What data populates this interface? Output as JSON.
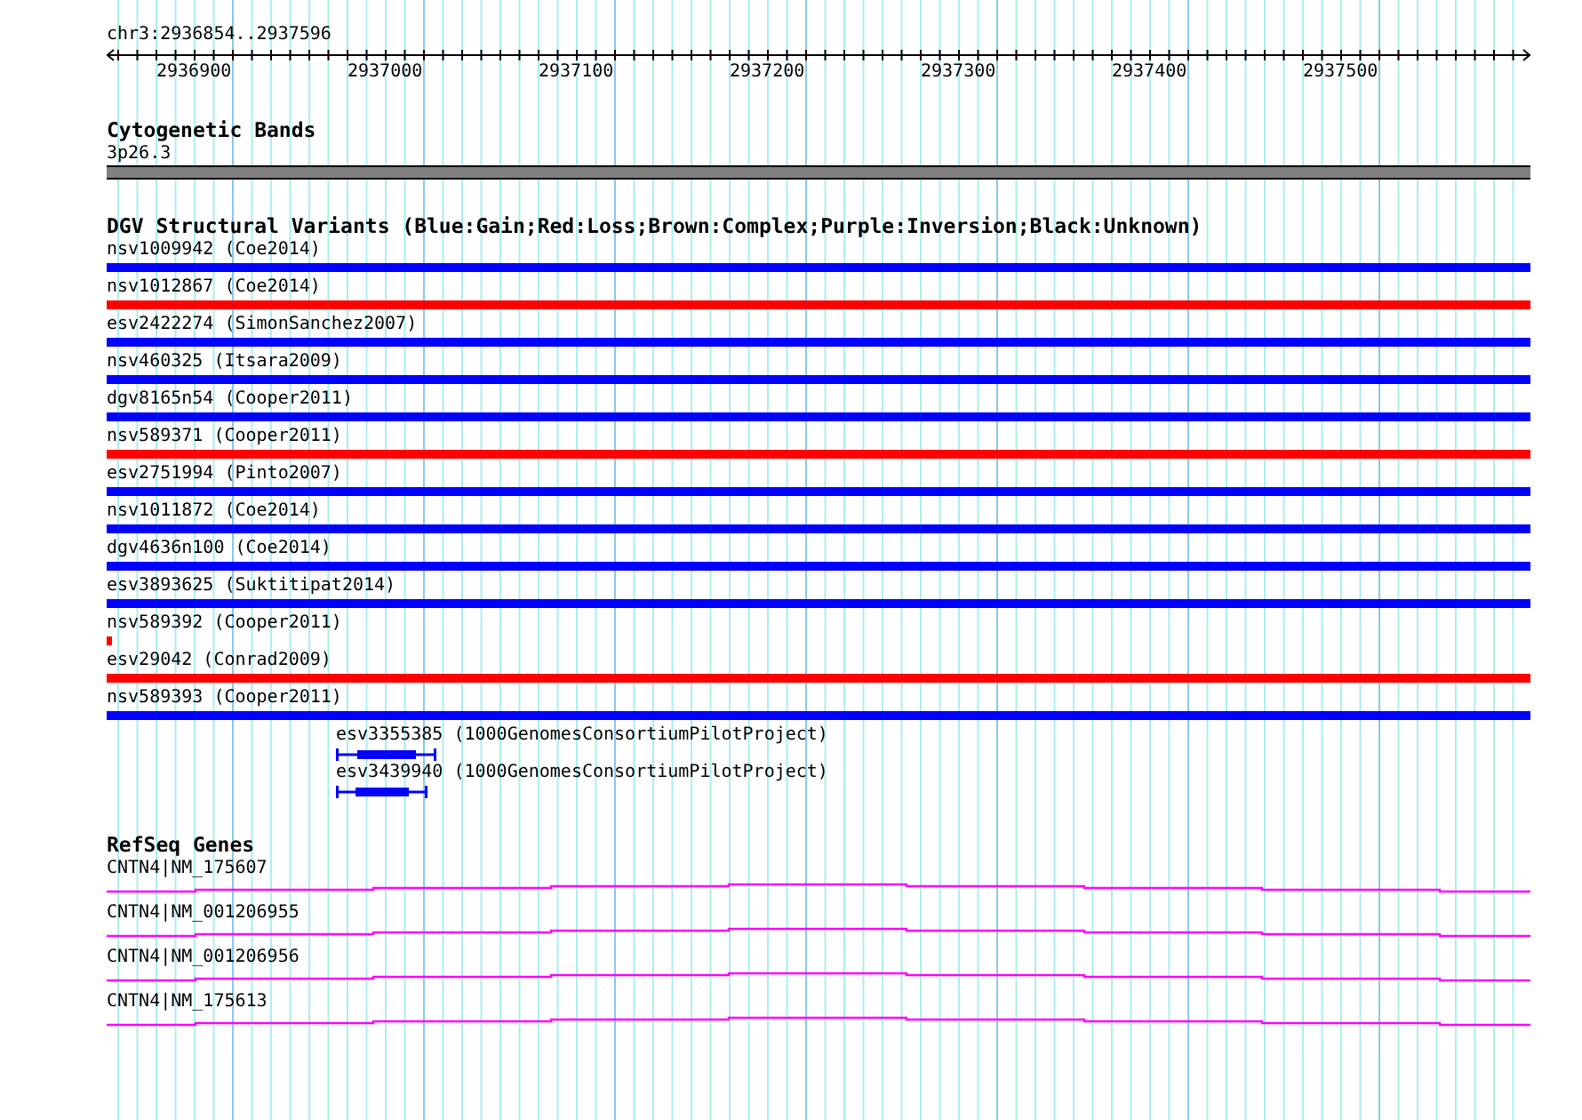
{
  "location": "chr3:2936854..2937596",
  "ruler": {
    "ticks": [
      "2936900",
      "2937000",
      "2937100",
      "2937200",
      "2937300",
      "2937400",
      "2937500"
    ]
  },
  "cytogenetic_bands": {
    "title": "Cytogenetic Bands",
    "band": "3p26.3"
  },
  "dgv": {
    "title": "DGV Structural Variants (Blue:Gain;Red:Loss;Brown:Complex;Purple:Inversion;Black:Unknown)",
    "variants": [
      {
        "label": "nsv1009942 (Coe2014)",
        "color": "#0000ff",
        "kind": "full"
      },
      {
        "label": "nsv1012867 (Coe2014)",
        "color": "#ff0000",
        "kind": "full"
      },
      {
        "label": "esv2422274 (SimonSanchez2007)",
        "color": "#0000ff",
        "kind": "full"
      },
      {
        "label": "nsv460325 (Itsara2009)",
        "color": "#0000ff",
        "kind": "full"
      },
      {
        "label": "dgv8165n54 (Cooper2011)",
        "color": "#0000ff",
        "kind": "full"
      },
      {
        "label": "nsv589371 (Cooper2011)",
        "color": "#ff0000",
        "kind": "full"
      },
      {
        "label": "esv2751994 (Pinto2007)",
        "color": "#0000ff",
        "kind": "full"
      },
      {
        "label": "nsv1011872 (Coe2014)",
        "color": "#0000ff",
        "kind": "full"
      },
      {
        "label": "dgv4636n100 (Coe2014)",
        "color": "#0000ff",
        "kind": "full"
      },
      {
        "label": "esv3893625 (Suktitipat2014)",
        "color": "#0000ff",
        "kind": "full"
      },
      {
        "label": "nsv589392 (Cooper2011)",
        "color": "#ff0000",
        "kind": "stub"
      },
      {
        "label": "esv29042 (Conrad2009)",
        "color": "#ff0000",
        "kind": "full"
      },
      {
        "label": "nsv589393 (Cooper2011)",
        "color": "#0000ff",
        "kind": "full"
      },
      {
        "label": "esv3355385 (1000GenomesConsortiumPilotProject)",
        "color": "#0000ff",
        "kind": "feature"
      },
      {
        "label": "esv3439940 (1000GenomesConsortiumPilotProject)",
        "color": "#0000ff",
        "kind": "feature"
      }
    ]
  },
  "refseq": {
    "title": "RefSeq Genes",
    "genes": [
      {
        "label": "CNTN4|NM_175607"
      },
      {
        "label": "CNTN4|NM_001206955"
      },
      {
        "label": "CNTN4|NM_001206956"
      },
      {
        "label": "CNTN4|NM_175613"
      }
    ]
  }
}
